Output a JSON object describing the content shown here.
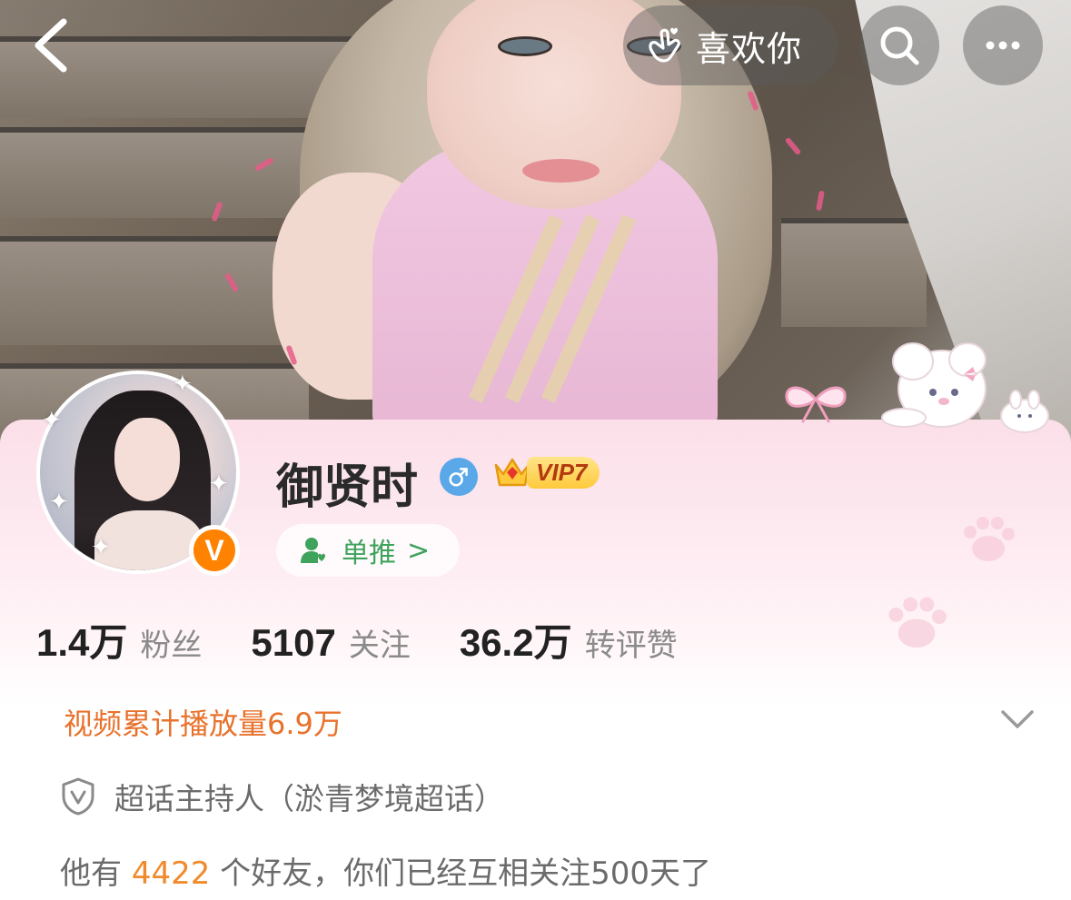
{
  "topbar": {
    "back_icon": "chevron-left-icon",
    "like_label": "喜欢你",
    "like_icon": "finger-heart-icon",
    "search_icon": "search-icon",
    "more_icon": "more-icon"
  },
  "profile": {
    "username": "御贤时",
    "gender_icon": "male-icon",
    "vip_label": "VIP7",
    "verified_badge": "V",
    "fan_tag": {
      "label": "单推",
      "arrow": ">"
    }
  },
  "stats": [
    {
      "num": "1.4万",
      "label": "粉丝"
    },
    {
      "num": "5107",
      "label": "关注"
    },
    {
      "num": "36.2万",
      "label": "转评赞"
    }
  ],
  "video_count": "视频累计播放量6.9万",
  "host_text": "超话主持人（淤青梦境超话）",
  "friends": {
    "prefix": "他有 ",
    "count": "4422",
    "suffix": " 个好友，你们已经互相关注500天了"
  },
  "colors": {
    "accent_orange": "#e8722c",
    "verified_orange": "#ff8200",
    "fan_green": "#3fa35c",
    "gender_blue": "#5aa8e8"
  }
}
